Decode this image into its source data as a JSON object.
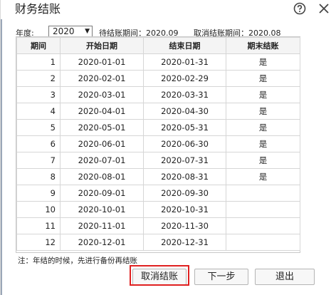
{
  "dialog": {
    "title": "财务结账"
  },
  "toolbar": {
    "year_label": "年度:",
    "year_value": "2020",
    "pending_label": "待结账期间：2020.09",
    "cancel_label": "取消结账期间：2020.08"
  },
  "table": {
    "headers": [
      "期间",
      "开始日期",
      "结束日期",
      "期末结账"
    ],
    "rows": [
      {
        "period": "1",
        "start": "2020-01-01",
        "end": "2020-01-31",
        "closed": "是"
      },
      {
        "period": "2",
        "start": "2020-02-01",
        "end": "2020-02-29",
        "closed": "是"
      },
      {
        "period": "3",
        "start": "2020-03-01",
        "end": "2020-03-31",
        "closed": "是"
      },
      {
        "period": "4",
        "start": "2020-04-01",
        "end": "2020-04-30",
        "closed": "是"
      },
      {
        "period": "5",
        "start": "2020-05-01",
        "end": "2020-05-31",
        "closed": "是"
      },
      {
        "period": "6",
        "start": "2020-06-01",
        "end": "2020-06-30",
        "closed": "是"
      },
      {
        "period": "7",
        "start": "2020-07-01",
        "end": "2020-07-31",
        "closed": "是"
      },
      {
        "period": "8",
        "start": "2020-08-01",
        "end": "2020-08-31",
        "closed": "是"
      },
      {
        "period": "9",
        "start": "2020-09-01",
        "end": "2020-09-30",
        "closed": ""
      },
      {
        "period": "10",
        "start": "2020-10-01",
        "end": "2020-10-31",
        "closed": ""
      },
      {
        "period": "11",
        "start": "2020-11-01",
        "end": "2020-11-30",
        "closed": ""
      },
      {
        "period": "12",
        "start": "2020-12-01",
        "end": "2020-12-31",
        "closed": ""
      }
    ]
  },
  "note": "注：年结的时候，先进行备份再结账",
  "buttons": {
    "cancel_close": "取消结账",
    "next": "下一步",
    "exit": "退出"
  },
  "icons": {
    "help": "help-icon",
    "close": "close-icon"
  },
  "colors": {
    "highlight": "#e02020"
  }
}
